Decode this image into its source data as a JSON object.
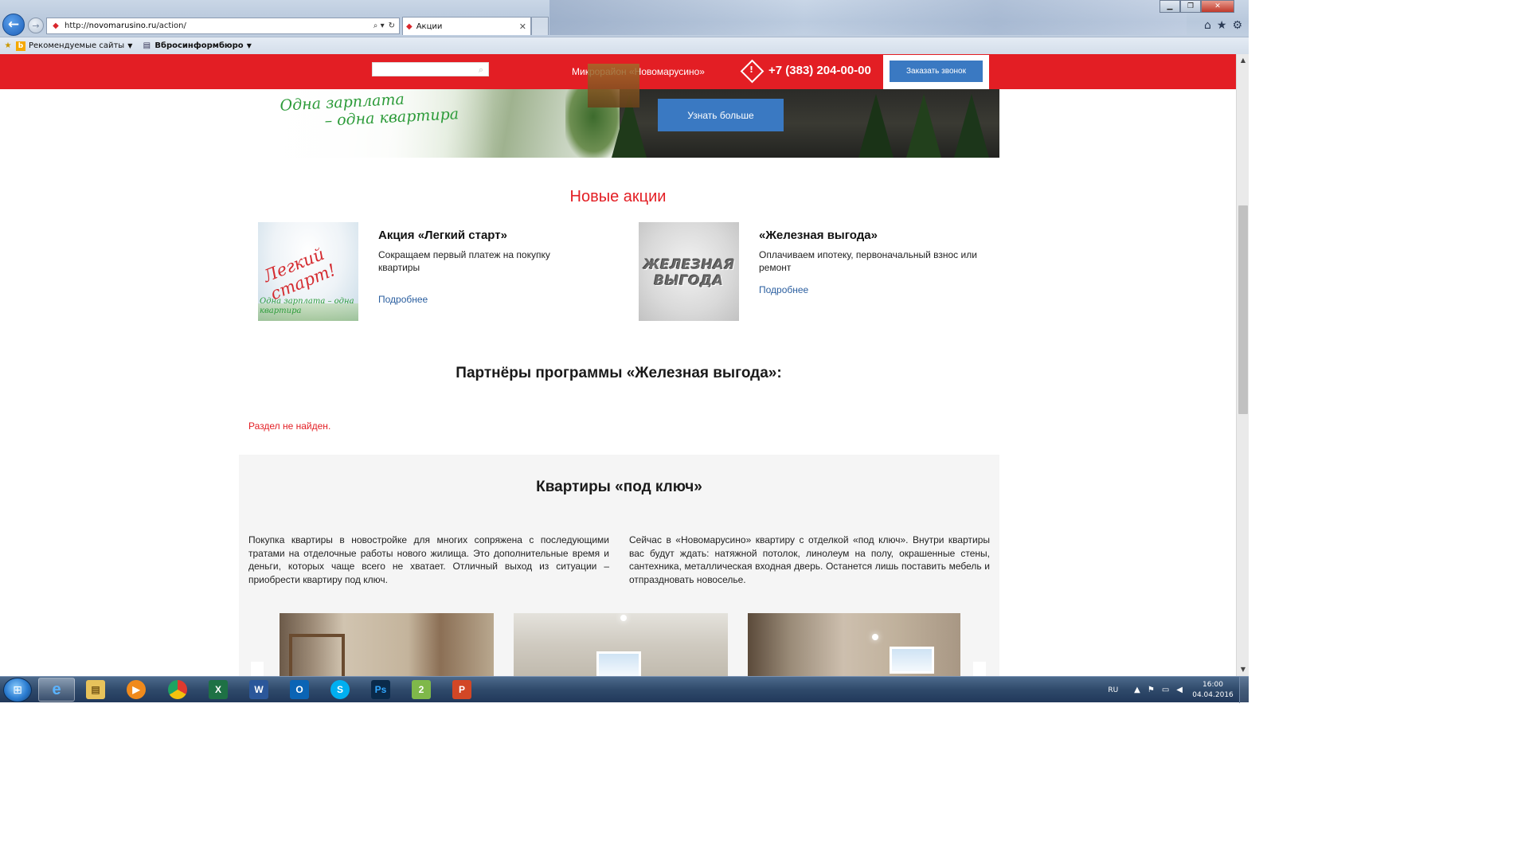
{
  "browser": {
    "url_prefix": "http://",
    "url_host": "novomarusino.ru",
    "url_path": "/action/",
    "tab_title": "Акции",
    "favorites": [
      {
        "label": "Рекомендуемые сайты",
        "icon": "bing-icon"
      },
      {
        "label": "Вбросинформбюро",
        "icon": "page-icon"
      }
    ]
  },
  "header": {
    "district": "Микрорайон «Новомарусино»",
    "phone": "+7 (383) 204-00-00",
    "callback_label": "Заказать звонок"
  },
  "hero": {
    "tagline_line1": "Одна зарплата",
    "tagline_line2": "– одна квартира",
    "button_label": "Узнать больше"
  },
  "promos": {
    "title": "Новые акции",
    "items": [
      {
        "title": "Акция «Легкий старт»",
        "description": "Сокращаем первый платеж на покупку квартиры",
        "more": "Подробнее",
        "image_text_main": "Легкий старт!",
        "image_text_sub": "Одна зарплата – одна квартира"
      },
      {
        "title": "«Железная выгода»",
        "description": "Оплачиваем ипотеку, первоначальный взнос или ремонт",
        "more": "Подробнее",
        "image_text_main": "ЖЕЛЕЗНАЯ ВЫГОДА"
      }
    ]
  },
  "partners": {
    "title": "Партнёры программы «Железная выгода»:",
    "not_found": "Раздел не найден."
  },
  "turnkey": {
    "title": "Квартиры «под ключ»",
    "text_left": "Покупка квартиры в новостройке для многих сопряжена с последующими тратами на отделочные работы нового жилища. Это дополнительные время и деньги, которых чаще всего не хватает. Отличный выход из ситуации – приобрести квартиру под ключ.",
    "text_right": "Сейчас в «Новомарусино» квартиру с отделкой «под ключ». Внутри квартиры вас будут ждать: натяжной потолок, линолеум на полу, окрашенные стены, сантехника, металлическая входная дверь. Останется лишь поставить мебель и отпраздновать новоселье."
  },
  "taskbar": {
    "apps": [
      {
        "name": "ie-icon",
        "glyph": "e"
      },
      {
        "name": "explorer-icon",
        "glyph": "▤"
      },
      {
        "name": "media-player-icon",
        "glyph": "▶"
      },
      {
        "name": "chrome-icon",
        "glyph": ""
      },
      {
        "name": "excel-icon",
        "glyph": "X"
      },
      {
        "name": "word-icon",
        "glyph": "W"
      },
      {
        "name": "outlook-icon",
        "glyph": "O"
      },
      {
        "name": "skype-icon",
        "glyph": "S"
      },
      {
        "name": "photoshop-icon",
        "glyph": "Ps"
      },
      {
        "name": "tool-icon",
        "glyph": "2"
      },
      {
        "name": "powerpoint-icon",
        "glyph": "P"
      }
    ],
    "language": "RU",
    "time": "16:00",
    "date": "04.04.2016"
  },
  "colors": {
    "brand_red": "#e31e24",
    "button_blue": "#3a79c2",
    "link_blue": "#2a5e9f"
  }
}
